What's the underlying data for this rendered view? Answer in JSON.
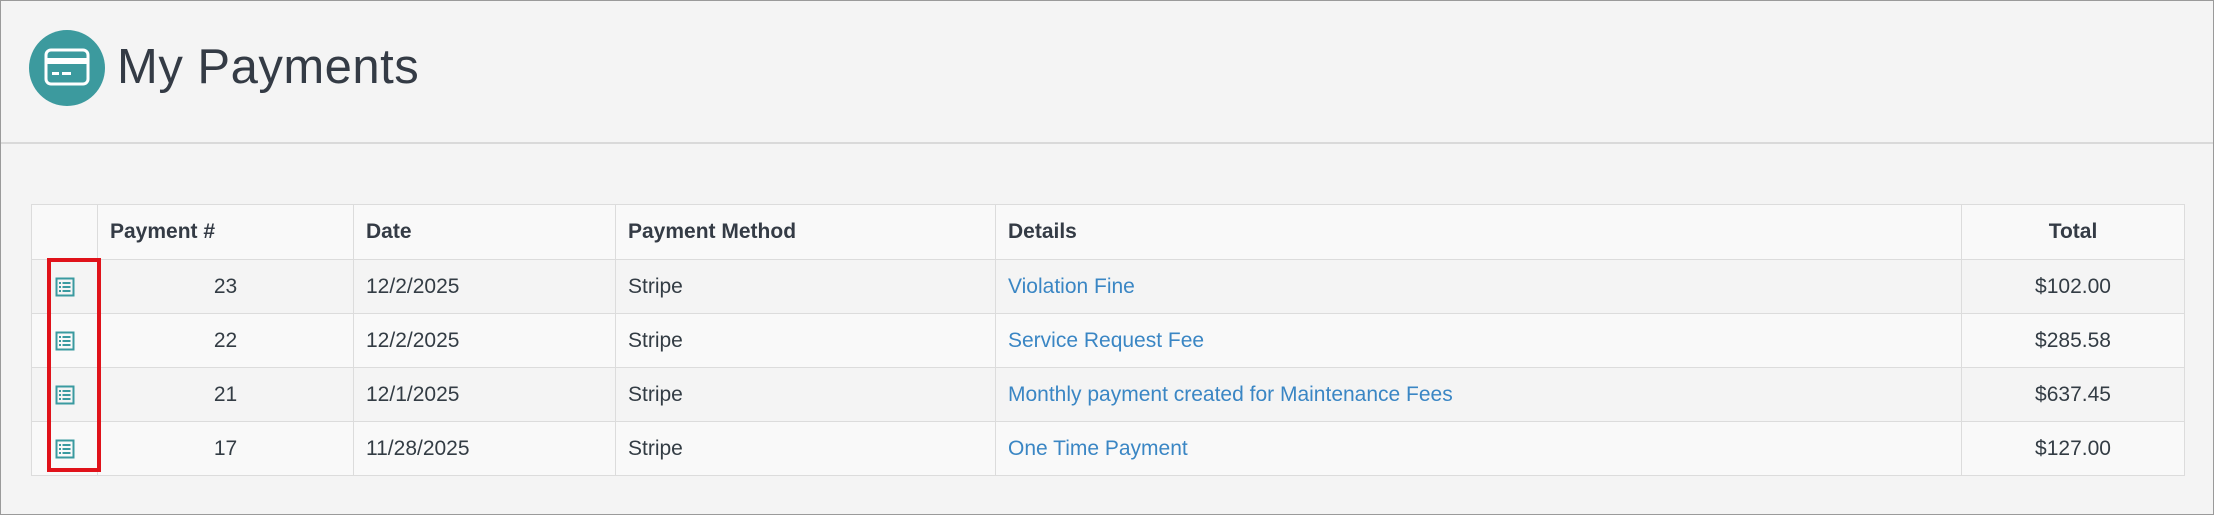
{
  "page": {
    "title": "My Payments",
    "title_icon": "credit-card-icon",
    "accent_color": "#3c9a9e",
    "link_color": "#3a86c4"
  },
  "table": {
    "columns": {
      "icon": "",
      "payment_num": "Payment #",
      "date": "Date",
      "method": "Payment Method",
      "details": "Details",
      "total": "Total"
    },
    "row_icon": "receipt-icon",
    "rows": [
      {
        "payment_num": "23",
        "date": "12/2/2025",
        "method": "Stripe",
        "details": "Violation Fine",
        "total": "$102.00"
      },
      {
        "payment_num": "22",
        "date": "12/2/2025",
        "method": "Stripe",
        "details": "Service Request Fee",
        "total": "$285.58"
      },
      {
        "payment_num": "21",
        "date": "12/1/2025",
        "method": "Stripe",
        "details": "Monthly payment created for Maintenance Fees",
        "total": "$637.45"
      },
      {
        "payment_num": "17",
        "date": "11/28/2025",
        "method": "Stripe",
        "details": "One Time Payment",
        "total": "$127.00"
      }
    ]
  },
  "annotation": {
    "highlight_color": "#e0121a"
  }
}
